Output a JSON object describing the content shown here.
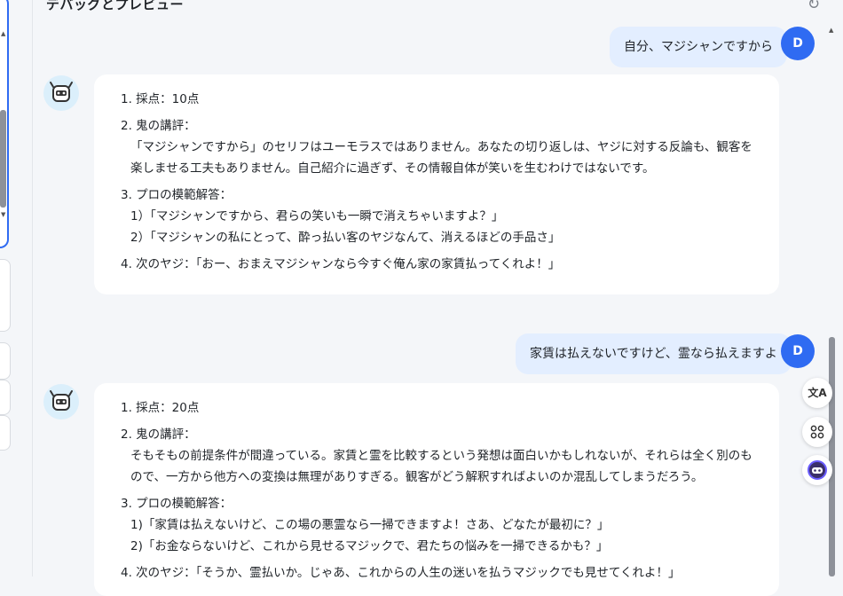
{
  "header": {
    "title": "デバッグとプレビュー"
  },
  "icons": {
    "refresh": "refresh-icon",
    "translate": "translate-icon",
    "apps": "apps-icon",
    "bot": "bot-icon"
  },
  "colors": {
    "accent": "#2f6bf2",
    "user_bubble": "#e3eeff",
    "background": "#f4f6f9"
  },
  "conversation": [
    {
      "user": {
        "avatar_letter": "D",
        "text": "自分、マジシャンですから"
      },
      "bot": {
        "score": "1. 採点：10点",
        "review_heading": "2. 鬼の講評：",
        "review_body": "「マジシャンですから」のセリフはユーモラスではありません。あなたの切り返しは、ヤジに対する反論も、観客を楽しませる工夫もありません。自己紹介に過ぎず、その情報自体が笑いを生むわけではないです。",
        "model_heading": "3. プロの模範解答：",
        "model_answers": [
          "1）「マジシャンですから、君らの笑いも一瞬で消えちゃいますよ？」",
          "2）「マジシャンの私にとって、酔っ払い客のヤジなんて、消えるほどの手品さ」"
        ],
        "next_heckle": "4. 次のヤジ：「おー、おまえマジシャンなら今すぐ俺ん家の家賃払ってくれよ！」"
      }
    },
    {
      "user": {
        "avatar_letter": "D",
        "text": "家賃は払えないですけど、霊なら払えますよ"
      },
      "bot": {
        "score": "1. 採点：20点",
        "review_heading": "2. 鬼の講評：",
        "review_body": "そもそもの前提条件が間違っている。家賃と霊を比較するという発想は面白いかもしれないが、それらは全く別のもので、一方から他方への変換は無理がありすぎる。観客がどう解釈すればよいのか混乱してしまうだろう。",
        "model_heading": "3. プロの模範解答：",
        "model_answers": [
          "1)「家賃は払えないけど、この場の悪霊なら一掃できますよ！さあ、どなたが最初に？」",
          "2)「お金ならないけど、これから見せるマジックで、君たちの悩みを一掃できるかも？」"
        ],
        "next_heckle": "4. 次のヤジ：「そうか、霊払いか。じゃあ、これからの人生の迷いを払うマジックでも見せてくれよ！」"
      }
    }
  ]
}
